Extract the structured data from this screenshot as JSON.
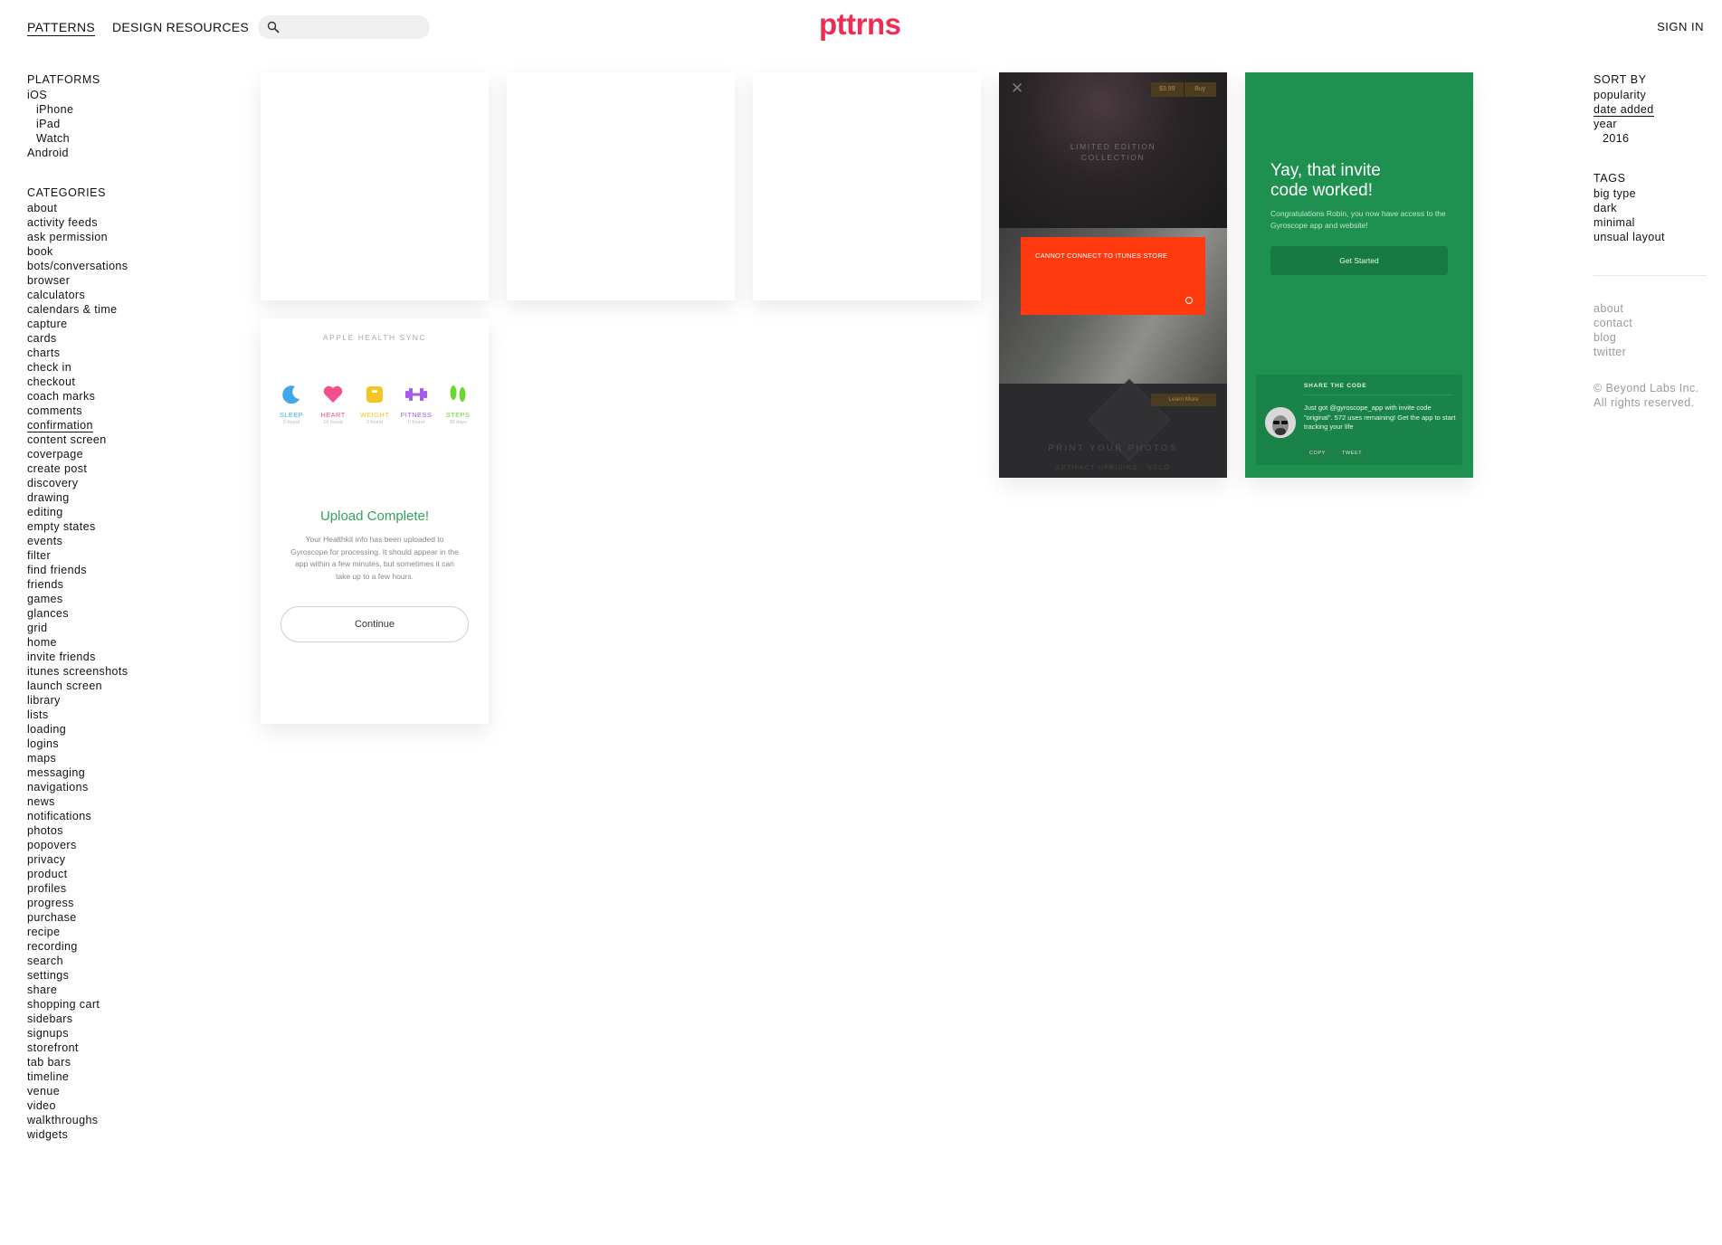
{
  "header": {
    "nav": [
      "PATTERNS",
      "DESIGN RESOURCES"
    ],
    "search_placeholder": "",
    "logo": "pttrns",
    "sign_in": "SIGN IN"
  },
  "sidebar_left": {
    "platforms_title": "PLATFORMS",
    "platforms": {
      "ios": "iOS",
      "iphone": "iPhone",
      "ipad": "iPad",
      "watch": "Watch",
      "android": "Android"
    },
    "categories_title": "CATEGORIES",
    "categories": [
      "about",
      "activity feeds",
      "ask permission",
      "book",
      "bots/conversations",
      "browser",
      "calculators",
      "calendars & time",
      "capture",
      "cards",
      "charts",
      "check in",
      "checkout",
      "coach marks",
      "comments",
      "confirmation",
      "content screen",
      "coverpage",
      "create post",
      "discovery",
      "drawing",
      "editing",
      "empty states",
      "events",
      "filter",
      "find friends",
      "friends",
      "games",
      "glances",
      "grid",
      "home",
      "invite friends",
      "itunes screenshots",
      "launch screen",
      "library",
      "lists",
      "loading",
      "logins",
      "maps",
      "messaging",
      "navigations",
      "news",
      "notifications",
      "photos",
      "popovers",
      "privacy",
      "product",
      "profiles",
      "progress",
      "purchase",
      "recipe",
      "recording",
      "search",
      "settings",
      "share",
      "shopping cart",
      "sidebars",
      "signups",
      "storefront",
      "tab bars",
      "timeline",
      "venue",
      "video",
      "walkthroughs",
      "widgets"
    ],
    "active_category": "confirmation"
  },
  "sidebar_right": {
    "sort_title": "SORT BY",
    "sort": {
      "popularity": "popularity",
      "date_added": "date added",
      "year": "year",
      "year_value": "2016"
    },
    "tags_title": "TAGS",
    "tags": [
      "big type",
      "dark",
      "minimal",
      "unsual layout"
    ],
    "footer_links": [
      "about",
      "contact",
      "blog",
      "twitter"
    ],
    "copyright": "© Beyond Labs Inc.",
    "rights": "All rights reserved."
  },
  "cards": {
    "health": {
      "title": "APPLE HEALTH SYNC",
      "metrics": [
        {
          "label": "SLEEP",
          "sub": "0 found",
          "color": "#3fa7e8",
          "icon": "moon-icon"
        },
        {
          "label": "HEART",
          "sub": "16 found",
          "color": "#f2508f",
          "icon": "heart-icon"
        },
        {
          "label": "WEIGHT",
          "sub": "3 found",
          "color": "#f5c523",
          "icon": "scale-icon"
        },
        {
          "label": "FITNESS",
          "sub": "0 found",
          "color": "#a35ce8",
          "icon": "dumbbell-icon"
        },
        {
          "label": "STEPS",
          "sub": "30 days",
          "color": "#6ad630",
          "icon": "footsteps-icon"
        }
      ],
      "headline": "Upload Complete!",
      "body": "Your Healthkit info has been uploaded to Gyroscope for processing. It should appear in the app within a few minutes, but sometimes it can take up to a few hours.",
      "button": "Continue"
    },
    "itunes": {
      "close": "✕",
      "price": "$3.99",
      "buy": "Buy",
      "collection_line1": "LIMITED EDITION",
      "collection_line2": "COLLECTION",
      "alert": "CANNOT CONNECT TO ITUNES STORE",
      "learn_more": "Learn More",
      "print": "PRINT YOUR PHOTOS",
      "print_sub": "ARTIFACT UPRISING · VSCO"
    },
    "invite": {
      "title_line1": "Yay, that invite",
      "title_line2": "code worked!",
      "body": "Congratulations Robin, you now have access to the Gyroscope app and website!",
      "button": "Get Started",
      "share_title": "SHARE THE CODE",
      "tweet": "Just got @gyroscope_app with invite code \"original\". 572 uses remaining! Get the app to start tracking your life",
      "copy": "COPY",
      "tweet_btn": "TWEET"
    }
  },
  "colors": {
    "brand": "#ef2c54",
    "alert": "#ff3a0f",
    "gyroscope_green": "#1e9150",
    "success": "#2ea55c"
  }
}
